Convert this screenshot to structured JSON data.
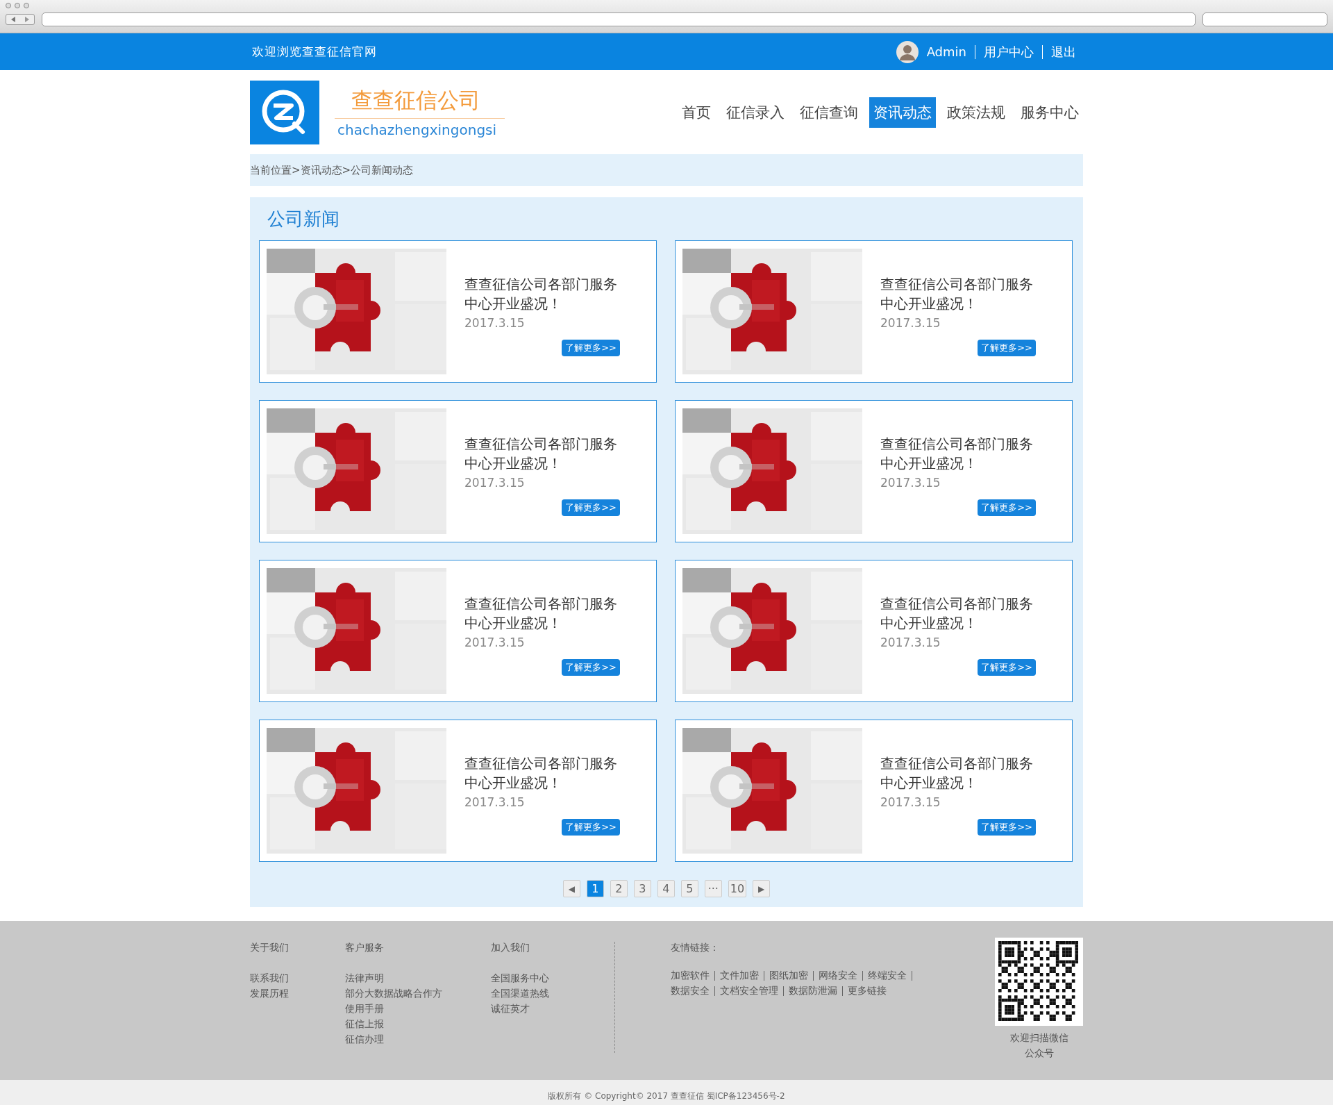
{
  "top_bar": {
    "welcome": "欢迎浏览查查征信官网",
    "user": "Admin",
    "links": [
      "用户中心",
      "退出"
    ]
  },
  "header": {
    "company_name": "查查征信公司",
    "company_pinyin": "chachazhengxingongsi",
    "nav": [
      {
        "label": "首页",
        "selected": false
      },
      {
        "label": "征信录入",
        "selected": false
      },
      {
        "label": "征信查询",
        "selected": false
      },
      {
        "label": "资讯动态",
        "selected": true
      },
      {
        "label": "政策法规",
        "selected": false
      },
      {
        "label": "服务中心",
        "selected": false
      }
    ]
  },
  "breadcrumb": "当前位置>资讯动态>公司新闻动态",
  "section": {
    "title": "公司新闻",
    "news": [
      {
        "title": "查查征信公司各部门服务中心开业盛况！",
        "date": "2017.3.15",
        "button": "了解更多>>"
      },
      {
        "title": "查查征信公司各部门服务中心开业盛况！",
        "date": "2017.3.15",
        "button": "了解更多>>"
      },
      {
        "title": "查查征信公司各部门服务中心开业盛况！",
        "date": "2017.3.15",
        "button": "了解更多>>"
      },
      {
        "title": "查查征信公司各部门服务中心开业盛况！",
        "date": "2017.3.15",
        "button": "了解更多>>"
      },
      {
        "title": "查查征信公司各部门服务中心开业盛况！",
        "date": "2017.3.15",
        "button": "了解更多>>"
      },
      {
        "title": "查查征信公司各部门服务中心开业盛况！",
        "date": "2017.3.15",
        "button": "了解更多>>"
      },
      {
        "title": "查查征信公司各部门服务中心开业盛况！",
        "date": "2017.3.15",
        "button": "了解更多>>"
      },
      {
        "title": "查查征信公司各部门服务中心开业盛况！",
        "date": "2017.3.15",
        "button": "了解更多>>"
      }
    ],
    "pagination": {
      "prev": "◀",
      "pages": [
        {
          "label": "1",
          "selected": true
        },
        {
          "label": "2",
          "selected": false
        },
        {
          "label": "3",
          "selected": false
        },
        {
          "label": "4",
          "selected": false
        },
        {
          "label": "5",
          "selected": false
        },
        {
          "label": "···",
          "selected": false
        },
        {
          "label": "10",
          "selected": false
        }
      ],
      "next": "▶"
    }
  },
  "footer": {
    "columns": [
      {
        "heading": "关于我们",
        "links": [
          "联系我们",
          "发展历程"
        ]
      },
      {
        "heading": "客户服务",
        "links": [
          "法律声明",
          "部分大数据战略合作方",
          "使用手册",
          "征信上报",
          "征信办理"
        ]
      },
      {
        "heading": "加入我们",
        "links": [
          "全国服务中心",
          "全国渠道热线",
          "诚征英才"
        ]
      }
    ],
    "friend_links": {
      "heading": "友情链接：",
      "links": [
        "加密软件",
        "文件加密",
        "图纸加密",
        "网络安全",
        "终端安全",
        "数据安全",
        "文档安全管理",
        "数据防泄漏",
        "更多链接"
      ]
    },
    "qr_caption": "欢迎扫描微信公众号"
  },
  "copyright": "版权所有 © Copyright© 2017 查查征信 蜀ICP备123456号-2"
}
